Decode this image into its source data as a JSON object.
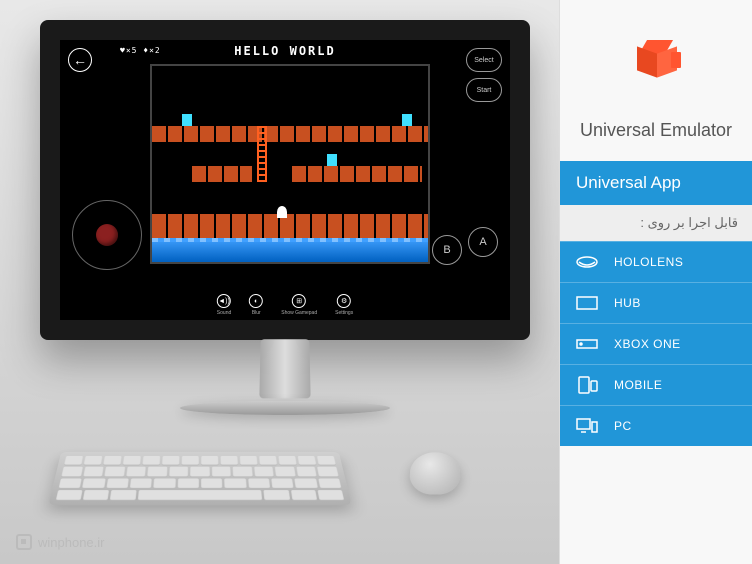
{
  "emulator": {
    "title": "HELLO WORLD",
    "hud": "♥×5 ♦×2",
    "buttons": {
      "select": "Select",
      "start": "Start",
      "a": "A",
      "b": "B"
    },
    "toolbar": [
      {
        "icon": "◄))",
        "label": "Sound"
      },
      {
        "icon": "◐",
        "label": "Blur"
      },
      {
        "icon": "⊞",
        "label": "Show Gamepad"
      },
      {
        "icon": "⚙",
        "label": "Settings"
      }
    ]
  },
  "sidebar": {
    "app_title": "Universal Emulator",
    "badge": "Universal App",
    "compat_label": "قابل اجرا بر روی :",
    "platforms": [
      {
        "name": "HOLOLENS",
        "icon": "hololens"
      },
      {
        "name": "HUB",
        "icon": "hub"
      },
      {
        "name": "XBOX ONE",
        "icon": "xbox"
      },
      {
        "name": "MOBILE",
        "icon": "mobile"
      },
      {
        "name": "PC",
        "icon": "pc"
      }
    ]
  },
  "watermark": "winphone.ir"
}
